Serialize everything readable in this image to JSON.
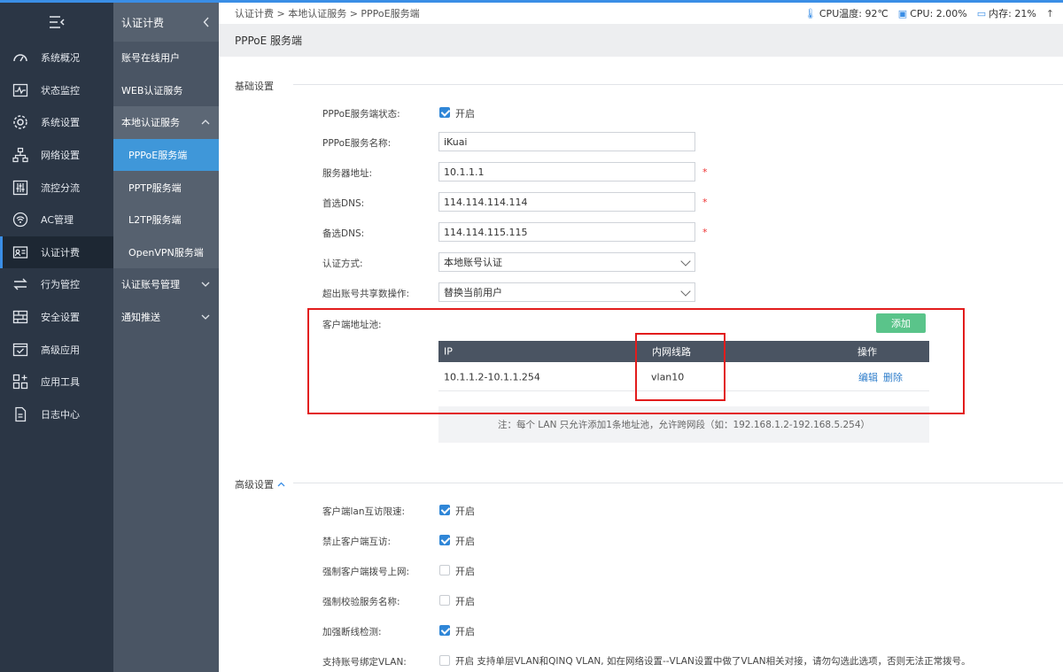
{
  "nav": {
    "items": [
      {
        "label": "系统概况",
        "icon": "gauge-icon"
      },
      {
        "label": "状态监控",
        "icon": "pulse-icon"
      },
      {
        "label": "系统设置",
        "icon": "gear-icon"
      },
      {
        "label": "网络设置",
        "icon": "network-icon"
      },
      {
        "label": "流控分流",
        "icon": "sliders-icon"
      },
      {
        "label": "AC管理",
        "icon": "wifi-icon"
      },
      {
        "label": "认证计费",
        "icon": "id-card-icon"
      },
      {
        "label": "行为管控",
        "icon": "swap-icon"
      },
      {
        "label": "安全设置",
        "icon": "firewall-icon"
      },
      {
        "label": "高级应用",
        "icon": "check-window-icon"
      },
      {
        "label": "应用工具",
        "icon": "apps-icon"
      },
      {
        "label": "日志中心",
        "icon": "document-icon"
      }
    ],
    "active_index": 6
  },
  "subnav": {
    "title": "认证计费",
    "items": [
      "账号在线用户",
      "WEB认证服务"
    ],
    "group_local": "本地认证服务",
    "children": [
      "PPPoE服务端",
      "PPTP服务端",
      "L2TP服务端",
      "OpenVPN服务端"
    ],
    "group_account": "认证账号管理",
    "group_notify": "通知推送"
  },
  "breadcrumb": "认证计费 > 本地认证服务 > PPPoE服务端",
  "status": {
    "cpu_temp": "CPU温度: 92℃",
    "cpu": "CPU: 2.00%",
    "memory": "内存: 21%"
  },
  "page_title": "PPPoE 服务端",
  "basic": {
    "section": "基础设置",
    "status_label": "PPPoE服务端状态:",
    "enabled_text": "开启",
    "name_label": "PPPoE服务名称:",
    "name_value": "iKuai",
    "server_label": "服务器地址:",
    "server_value": "10.1.1.1",
    "dns1_label": "首选DNS:",
    "dns1_value": "114.114.114.114",
    "dns2_label": "备选DNS:",
    "dns2_value": "114.114.115.115",
    "auth_label": "认证方式:",
    "auth_value": "本地账号认证",
    "exceed_label": "超出账号共享数操作:",
    "exceed_value": "替换当前用户",
    "required_mark": "*"
  },
  "pool": {
    "label": "客户端地址池:",
    "add_button": "添加",
    "columns": [
      "IP",
      "内网线路",
      "操作"
    ],
    "rows": [
      {
        "ip": "10.1.1.2-10.1.1.254",
        "line": "vlan10",
        "edit": "编辑",
        "delete": "删除"
      }
    ],
    "note": "注：每个 LAN 只允许添加1条地址池，允许跨网段（如：192.168.1.2-192.168.5.254）"
  },
  "advanced": {
    "section": "高级设置",
    "options": [
      {
        "label": "客户端lan互访限速:",
        "checked": true,
        "text": "开启"
      },
      {
        "label": "禁止客户端互访:",
        "checked": true,
        "text": "开启"
      },
      {
        "label": "强制客户端拨号上网:",
        "checked": false,
        "text": "开启"
      },
      {
        "label": "强制校验服务名称:",
        "checked": false,
        "text": "开启"
      },
      {
        "label": "加强断线检测:",
        "checked": true,
        "text": "开启"
      },
      {
        "label": "支持账号绑定VLAN:",
        "checked": false,
        "text": "开启 支持单层VLAN和QINQ VLAN, 如在网络设置--VLAN设置中做了VLAN相关对接，请勿勾选此选项，否则无法正常拨号。"
      }
    ]
  },
  "colors": {
    "accent": "#3a8ee6",
    "sidebar": "#2b3645",
    "subnav": "#4a5564",
    "add": "#5ac48a",
    "highlight": "#e21c1c"
  }
}
